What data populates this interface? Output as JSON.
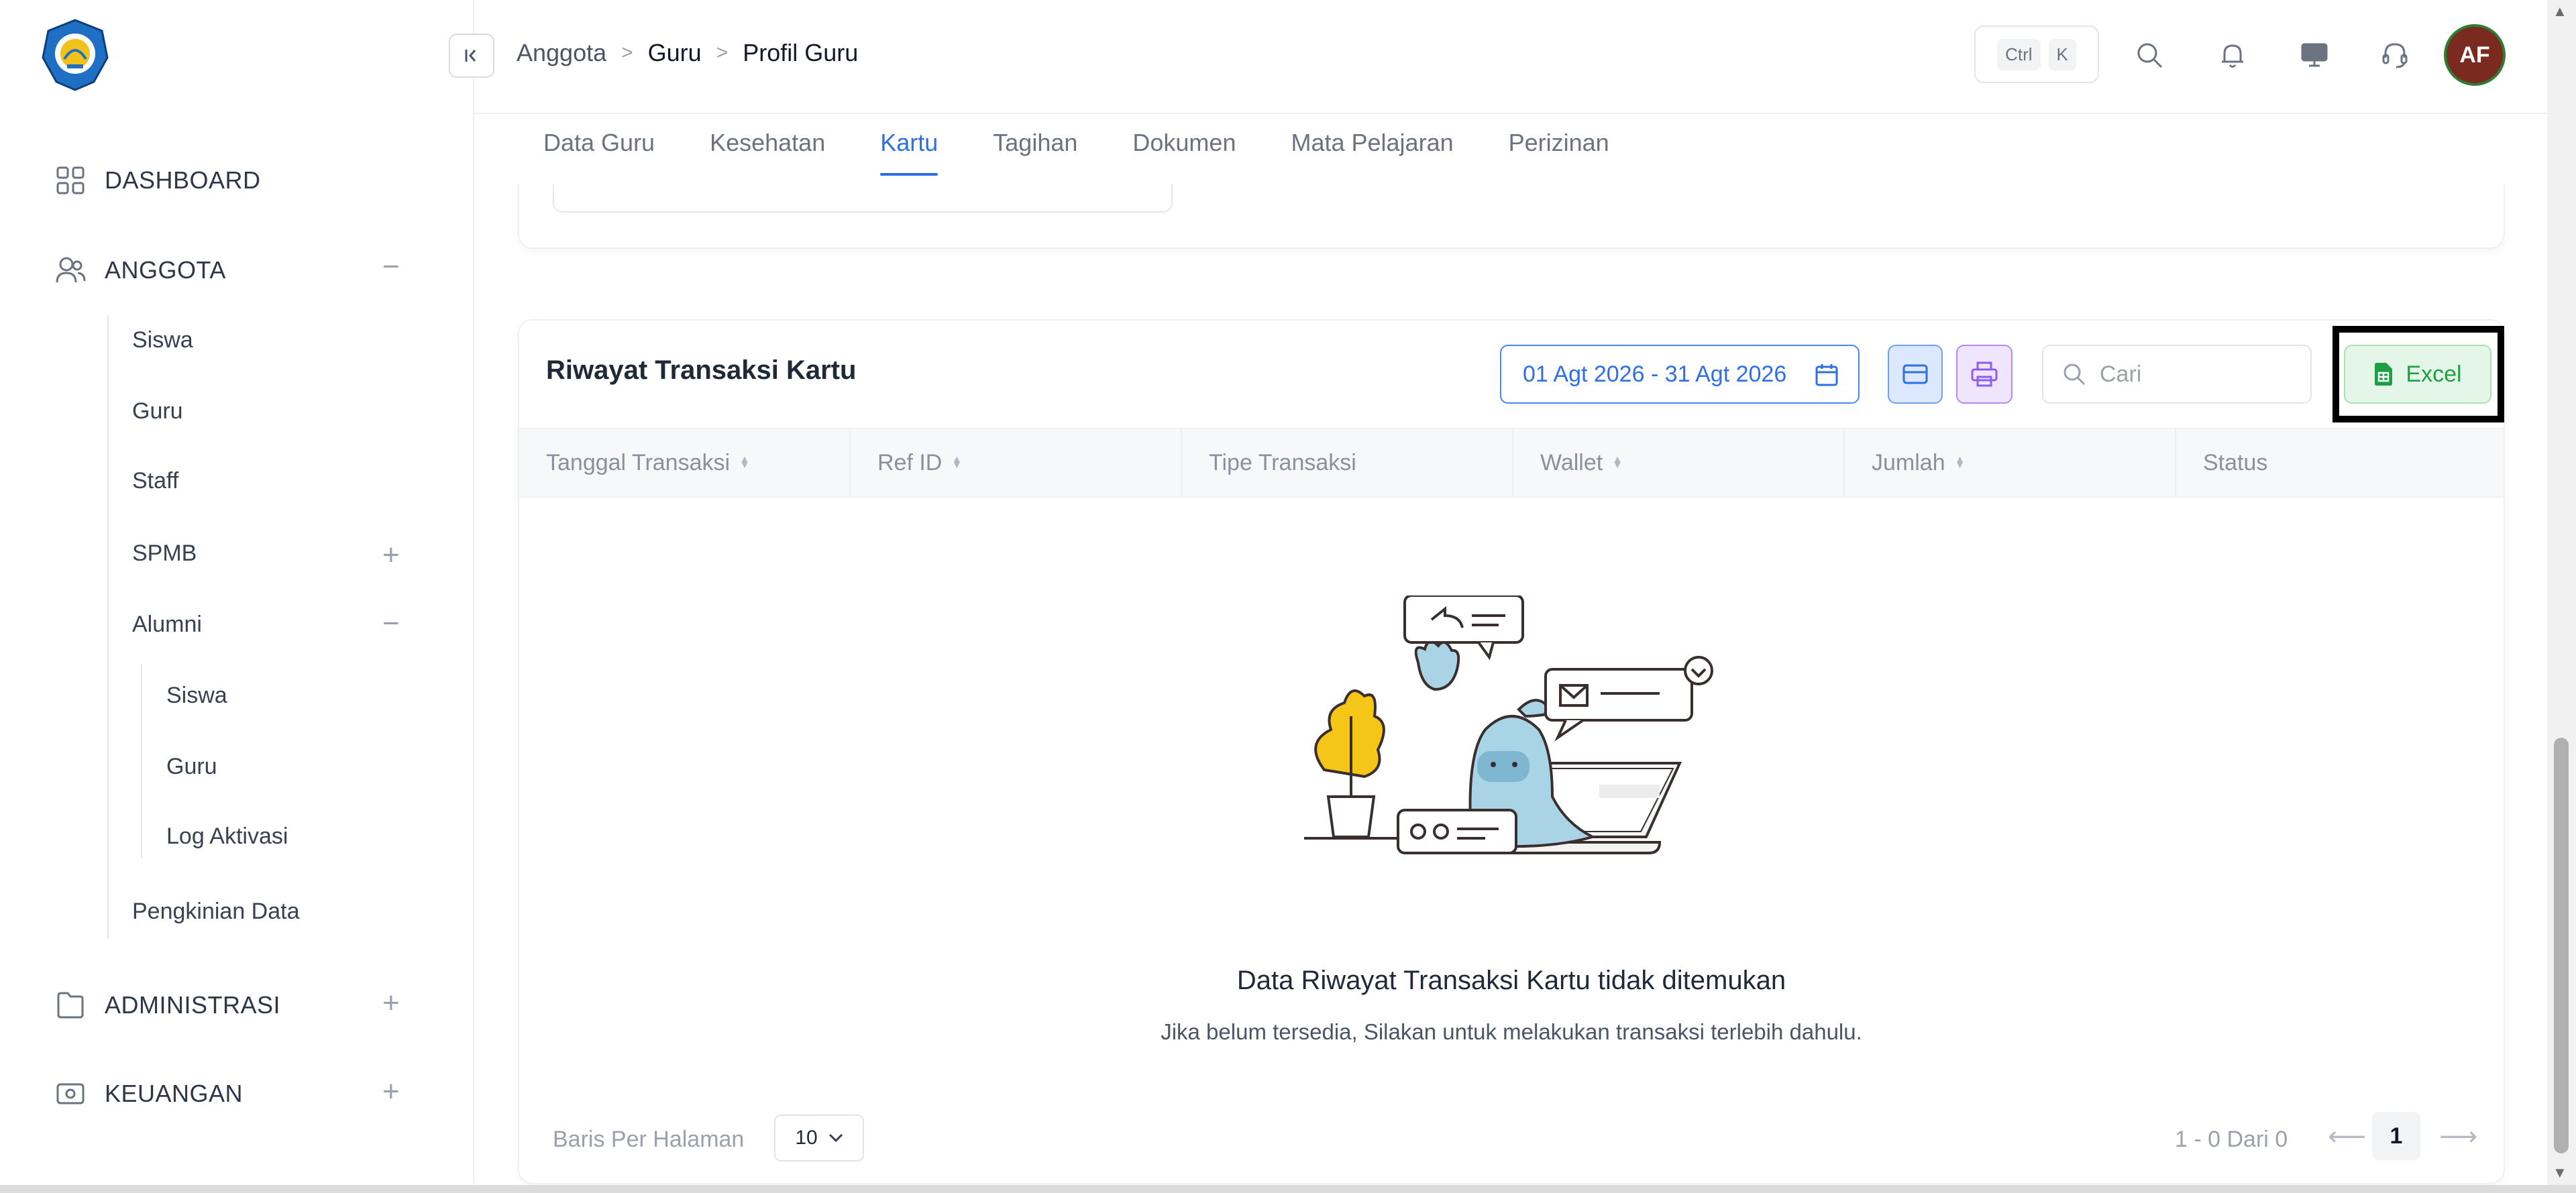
{
  "sidebar": {
    "sections": [
      {
        "label": "DASHBOARD",
        "icon": "grid-icon",
        "toggle": ""
      },
      {
        "label": "ANGGOTA",
        "icon": "users-icon",
        "toggle": "−"
      },
      {
        "label": "ADMINISTRASI",
        "icon": "folder-icon",
        "toggle": "+"
      },
      {
        "label": "KEUANGAN",
        "icon": "wallet-icon",
        "toggle": "+"
      }
    ],
    "anggota_items": {
      "siswa": "Siswa",
      "guru": "Guru",
      "staff": "Staff",
      "spmb": "SPMB",
      "spmb_toggle": "+",
      "alumni": "Alumni",
      "alumni_toggle": "−",
      "alumni_siswa": "Siswa",
      "alumni_guru": "Guru",
      "log_aktivasi": "Log Aktivasi",
      "pengkinian": "Pengkinian Data"
    }
  },
  "header": {
    "breadcrumb": [
      "Anggota",
      "Guru",
      "Profil Guru"
    ],
    "kbd": [
      "Ctrl",
      "K"
    ],
    "avatar_initials": "AF"
  },
  "tabs": [
    "Data Guru",
    "Kesehatan",
    "Kartu",
    "Tagihan",
    "Dokumen",
    "Mata Pelajaran",
    "Perizinan"
  ],
  "active_tab": "Kartu",
  "card": {
    "title": "Riwayat Transaksi Kartu",
    "date_range": "01 Agt 2026 - 31 Agt 2026",
    "search_placeholder": "Cari",
    "excel_label": "Excel",
    "columns": [
      "Tanggal Transaksi",
      "Ref ID",
      "Tipe Transaksi",
      "Wallet",
      "Jumlah",
      "Status"
    ],
    "empty_title": "Data Riwayat Transaksi Kartu tidak ditemukan",
    "empty_subtitle": "Jika belum tersedia, Silakan untuk melakukan transaksi terlebih dahulu.",
    "rows_label": "Baris Per Halaman",
    "rows_value": "10",
    "pagination_info": "1 - 0 Dari 0",
    "current_page": "1"
  },
  "colors": {
    "accent": "#2f6fe4",
    "excel_green": "#1e9e45",
    "print_purple": "#8b5cf6"
  }
}
